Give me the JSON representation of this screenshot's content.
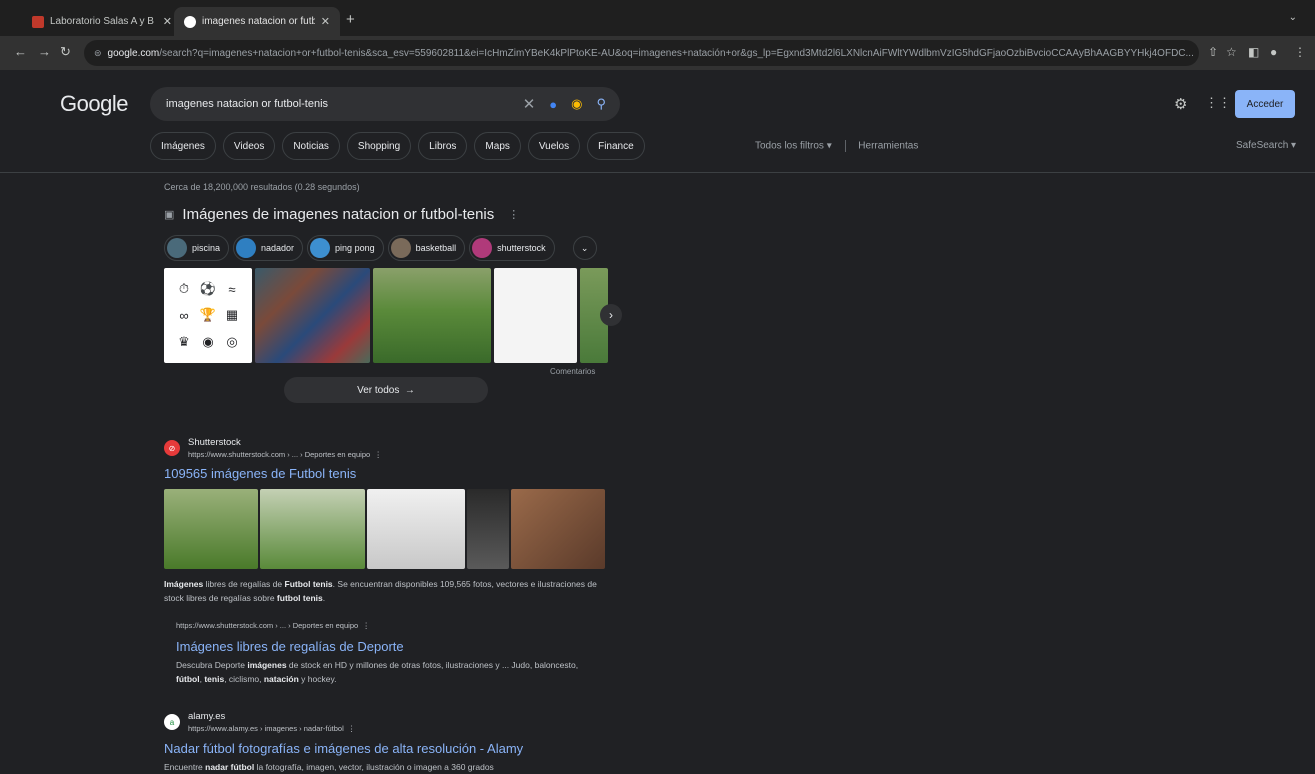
{
  "tabs": [
    {
      "title": "Laboratorio Salas A y B",
      "active": false
    },
    {
      "title": "imagenes natacion or futbol-t",
      "active": true
    }
  ],
  "toolbar": {
    "url_domain": "google.com",
    "url_rest": "/search?q=imagenes+natacion+or+futbol-tenis&sca_esv=559602811&ei=IcHmZimYBeK4kPlPtoKE-AU&oq=imagenes+natación+or&gs_lp=Egxnd3Mtd2l6LXNlcnAiFWltYWdlbmVzIG5hdGFjaoOzbiBvcioCCAAyBhAAGBYYHkj4OFDC..."
  },
  "google": {
    "logo": "Google",
    "query": "imagenes natacion or futbol-tenis",
    "signin_label": "Acceder",
    "chips": [
      "Imágenes",
      "Videos",
      "Noticias",
      "Shopping",
      "Libros",
      "Maps",
      "Vuelos",
      "Finance"
    ],
    "all_filters": "Todos los filtros",
    "tools": "Herramientas",
    "safesearch": "SafeSearch",
    "stats": "Cerca de 18,200,000 resultados (0.28 segundos)"
  },
  "images_block": {
    "heading": "Imágenes de imagenes natacion or futbol-tenis",
    "related": [
      "piscina",
      "nadador",
      "ping pong",
      "basketball",
      "shutterstock"
    ],
    "comments": "Comentarios",
    "see_all": "Ver todos"
  },
  "results": [
    {
      "site": "Shutterstock",
      "url": "https://www.shutterstock.com › ... › Deportes en equipo",
      "title": "109565 imágenes de Futbol tenis",
      "snippet_html": [
        "Imágenes",
        " libres de regalías de ",
        "Futbol tenis",
        ". Se encuentran disponibles 109,565 fotos, vectores e ilustraciones de stock libres de regalías sobre ",
        "futbol tenis",
        "."
      ],
      "sub": {
        "url": "https://www.shutterstock.com › ... › Deportes en equipo",
        "title": "Imágenes libres de regalías de Deporte",
        "snippet": [
          "Descubra Deporte ",
          "imágenes",
          " de stock en HD y millones de otras fotos, ilustraciones y ... Judo, baloncesto, ",
          "fútbol",
          ", ",
          "tenis",
          ", ciclismo, ",
          "natación",
          " y hockey."
        ]
      }
    },
    {
      "site": "alamy.es",
      "url": "https://www.alamy.es › imagenes › nadar-fútbol",
      "title": "Nadar fútbol fotografías e imágenes de alta resolución - Alamy",
      "snippet": [
        "Encuentre ",
        "nadar fútbol",
        " la fotografía, imagen, vector, ilustración o imagen a 360 grados"
      ]
    }
  ],
  "colors": {
    "link": "#8ab4f8",
    "bg": "#202124",
    "accent": "#8ab4f8"
  }
}
